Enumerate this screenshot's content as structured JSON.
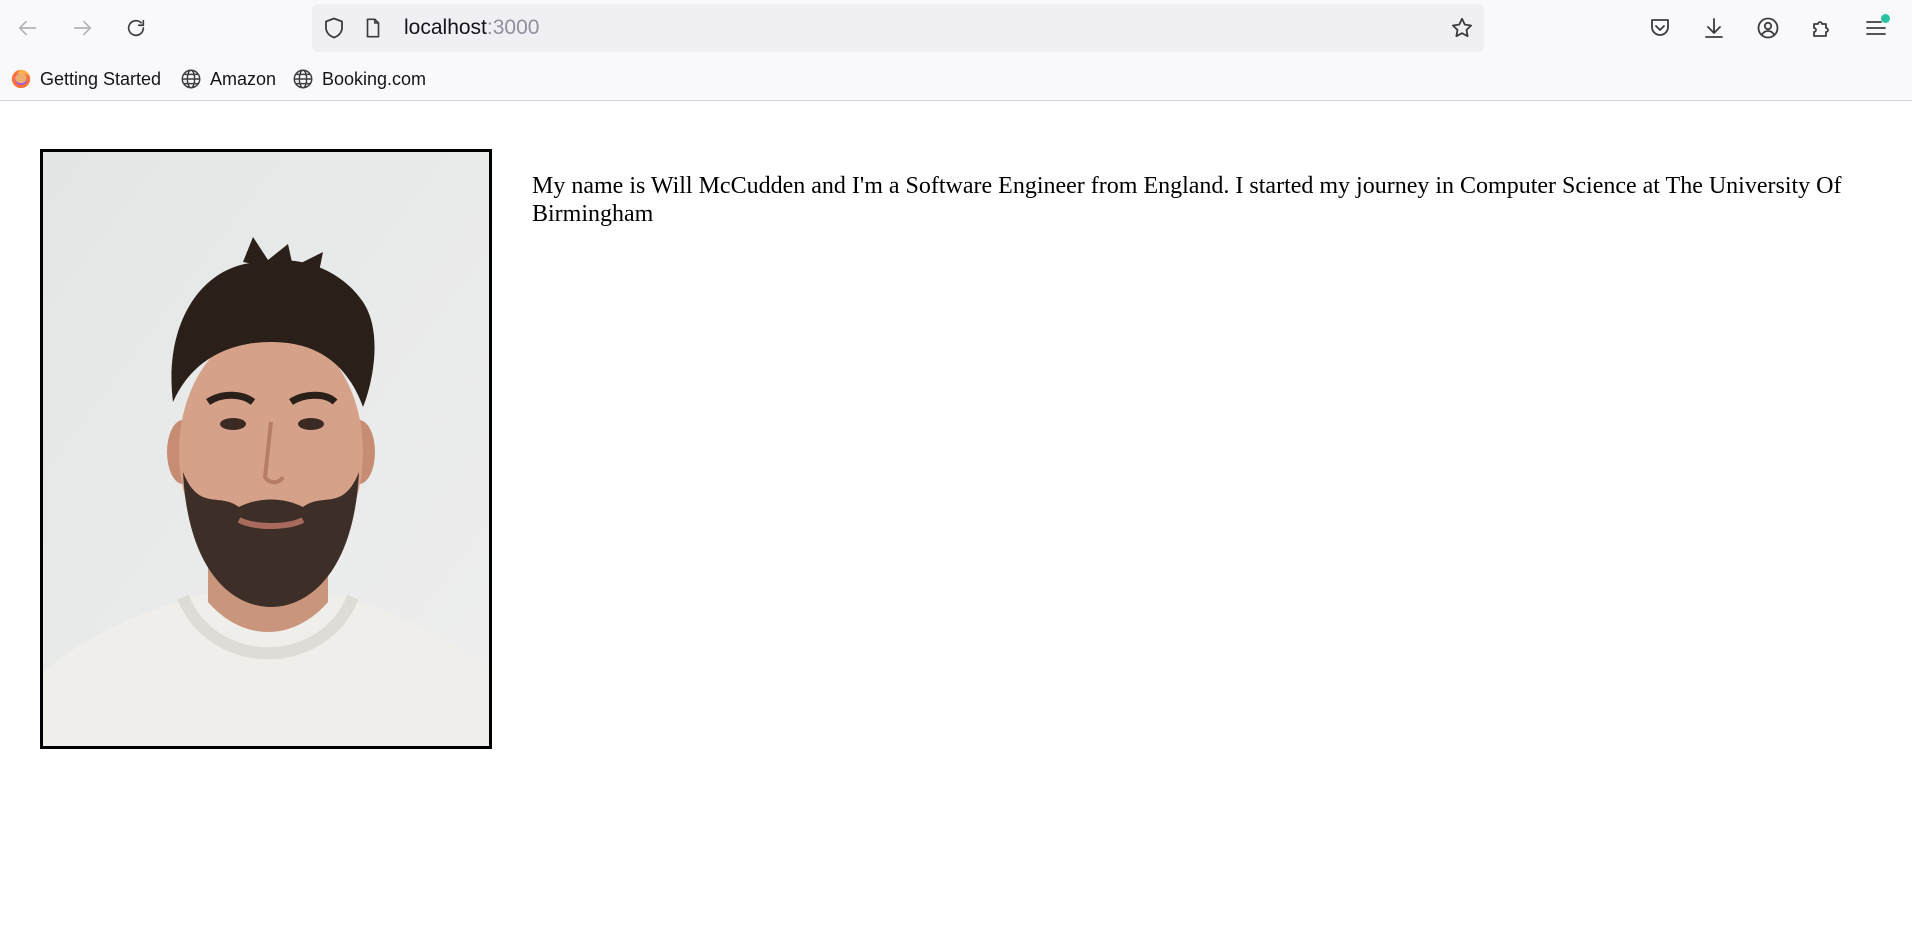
{
  "browser": {
    "url_host": "localhost",
    "url_port": ":3000",
    "bookmarks": [
      {
        "label": "Getting Started",
        "icon": "firefox-icon"
      },
      {
        "label": "Amazon",
        "icon": "globe-icon"
      },
      {
        "label": "Booking.com",
        "icon": "globe-icon"
      }
    ],
    "accent_dot_color": "#2ac3a2"
  },
  "page": {
    "bio": "My name is Will McCudden and I'm a Software Engineer from England. I started my journey in Computer Science at The University Of Birmingham"
  }
}
